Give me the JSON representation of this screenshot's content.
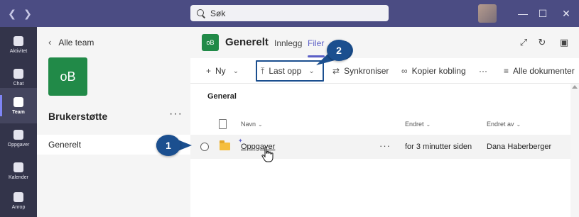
{
  "titlebar": {
    "back_icon": "chevron-left-icon",
    "forward_icon": "chevron-right-icon",
    "search_placeholder": "Søk",
    "window_controls": {
      "more": "···",
      "minimize": "—",
      "maximize": "☐",
      "close": "✕"
    }
  },
  "rail": {
    "items": [
      {
        "label": "Aktivitet",
        "icon": "bell-icon"
      },
      {
        "label": "Chat",
        "icon": "chat-icon"
      },
      {
        "label": "Team",
        "icon": "teams-icon",
        "active": true
      },
      {
        "label": "Oppgaver",
        "icon": "assignments-icon"
      },
      {
        "label": "Kalender",
        "icon": "calendar-icon"
      },
      {
        "label": "Anrop",
        "icon": "phone-icon"
      }
    ]
  },
  "teampanel": {
    "back_label": "Alle team",
    "team_initials": "oB",
    "team_name": "Brukerstøtte",
    "more": "···",
    "channels": [
      {
        "label": "Generelt"
      }
    ]
  },
  "channel_header": {
    "initials": "oB",
    "title": "Generelt",
    "tabs": [
      {
        "label": "Innlegg"
      },
      {
        "label": "Filer",
        "active": true
      }
    ]
  },
  "toolbar": {
    "new_label": "Ny",
    "upload_label": "Last opp",
    "sync_label": "Synkroniser",
    "copy_link_label": "Kopier kobling",
    "more": "···",
    "view_label": "Alle dokumenter"
  },
  "files": {
    "section_title": "General",
    "columns": {
      "name": "Navn",
      "modified": "Endret",
      "modified_by": "Endret av"
    },
    "rows": [
      {
        "name": "Oppgaver",
        "modified": "for 3 minutter siden",
        "modified_by": "Dana Haberberger",
        "more": "···"
      }
    ]
  },
  "callouts": {
    "one": "1",
    "two": "2"
  },
  "colors": {
    "titlebar": "#4b4c83",
    "rail": "#33344a",
    "accent": "#5b5fc7",
    "team_tile": "#218a48",
    "callout": "#1b4f8f"
  }
}
